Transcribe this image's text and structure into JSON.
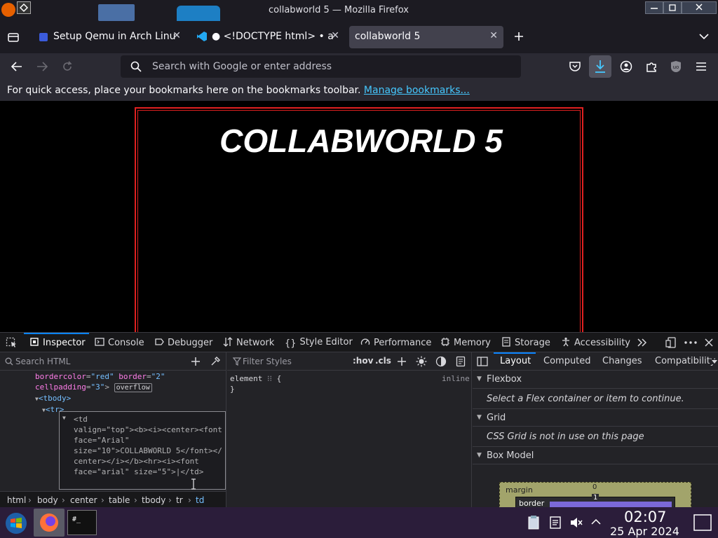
{
  "window": {
    "title": "collabworld 5 — Mozilla Firefox"
  },
  "tabs": [
    {
      "label": "Setup Qemu in Arch Linu",
      "active": false
    },
    {
      "label": "● <!DOCTYPE html> • a",
      "active": false
    },
    {
      "label": "collabworld 5",
      "active": true
    }
  ],
  "navbar": {
    "url_placeholder": "Search with Google or enter address"
  },
  "bookmarks": {
    "prompt": "For quick access, place your bookmarks here on the bookmarks toolbar.",
    "link": "Manage bookmarks..."
  },
  "page": {
    "heading": "COLLABWORLD 5",
    "border_color": "#e02020"
  },
  "devtools": {
    "tabs": [
      "Inspector",
      "Console",
      "Debugger",
      "Network",
      "Style Editor",
      "Performance",
      "Memory",
      "Storage",
      "Accessibility"
    ],
    "markup": {
      "search_placeholder": "Search HTML",
      "line1": {
        "attr1": "bordercolor",
        "val1": "\"red\"",
        "attr2": "border",
        "val2": "\"2\""
      },
      "line2": {
        "attr": "cellpadding",
        "val": "\"3\"",
        "badge": "overflow"
      },
      "tbody": "<tbody>",
      "tr": "<tr>",
      "sel_lines": [
        "<td",
        "valign=\"top\"><b><i><center><font",
        "face=\"Arial\"",
        "size=\"10\">COLLABWORLD 5</font></",
        "center></i></b><hr><i><font",
        "face=\"arial\" size=\"5\">|</td>"
      ]
    },
    "breadcrumbs": [
      "html",
      "body",
      "center",
      "table",
      "tbody",
      "tr",
      "td"
    ],
    "rules": {
      "filter_placeholder": "Filter Styles",
      "pseudo": ":hov",
      "cls": ".cls",
      "selector": "element",
      "open_brace": "{",
      "close_brace": "}",
      "source": "inline"
    },
    "layout": {
      "tabs": [
        "Layout",
        "Computed",
        "Changes",
        "Compatibility"
      ],
      "flexbox_title": "Flexbox",
      "flexbox_msg": "Select a Flex container or item to continue.",
      "grid_title": "Grid",
      "grid_msg": "CSS Grid is not in use on this page",
      "boxmodel_title": "Box Model",
      "margin_label": "margin",
      "margin_top": "0",
      "border_label": "border",
      "border_top": "1"
    }
  },
  "taskbar": {
    "time": "02:07",
    "date": "25 Apr 2024",
    "terminal_label": "#_"
  }
}
